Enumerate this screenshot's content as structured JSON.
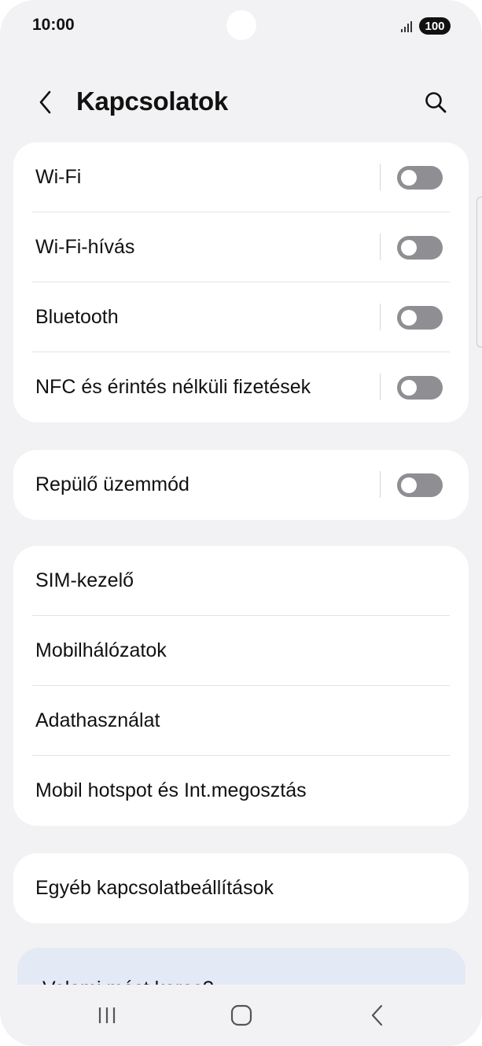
{
  "status_bar": {
    "time": "10:00",
    "battery": "100",
    "icons": [
      "signal-icon",
      "battery-icon"
    ]
  },
  "header": {
    "title": "Kapcsolatok",
    "icons": [
      "back-icon",
      "search-icon"
    ]
  },
  "groups": {
    "connections": [
      {
        "label": "Wi-Fi",
        "toggle": "off"
      },
      {
        "label": "Wi-Fi-hívás",
        "toggle": "off"
      },
      {
        "label": "Bluetooth",
        "toggle": "off"
      },
      {
        "label": "NFC és érintés nélküli fizetések",
        "toggle": "off"
      }
    ],
    "airplane": {
      "label": "Repülő üzemmód",
      "toggle": "off"
    },
    "network": [
      {
        "label": "SIM-kezelő"
      },
      {
        "label": "Mobilhálózatok"
      },
      {
        "label": "Adathasználat"
      },
      {
        "label": "Mobil hotspot és Int.megosztás"
      }
    ],
    "other": {
      "label": "Egyéb kapcsolatbeállítások"
    }
  },
  "help_card": {
    "text": "Valami mást keres?"
  },
  "nav_bar": {
    "icons": [
      "recent-apps-icon",
      "home-icon",
      "back-nav-icon"
    ]
  },
  "colors": {
    "background": "#f2f2f4",
    "card": "#ffffff",
    "toggle_off": "#8e8e93",
    "help_card": "#e3eaf6"
  }
}
